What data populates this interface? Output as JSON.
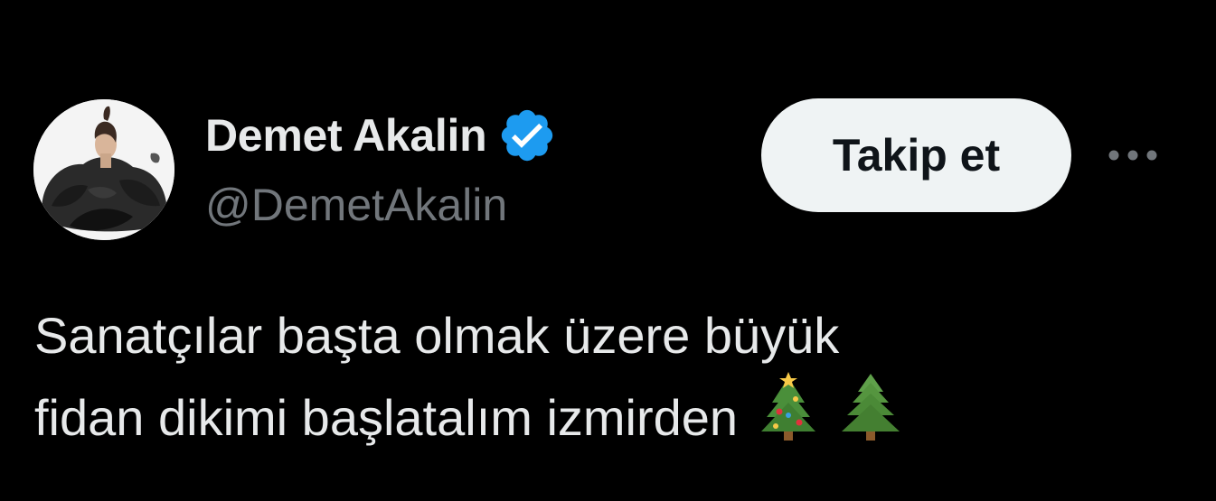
{
  "user": {
    "display_name": "Demet Akalin",
    "handle": "@DemetAkalin",
    "verified_icon": "verified-badge-icon",
    "verified_color": "#1d9bf0"
  },
  "actions": {
    "follow_label": "Takip et",
    "more_icon": "more-horizontal-icon"
  },
  "tweet": {
    "lines": [
      "Sanatçılar başta olmak üzere büyük",
      "fidan dikimi başlatalım izmirden"
    ],
    "emojis": [
      "christmas-tree-icon",
      "evergreen-tree-icon"
    ]
  },
  "colors": {
    "background": "#000000",
    "primary_text": "#e7e9ea",
    "secondary_text": "#71767b",
    "button_bg": "#eff3f4",
    "button_text": "#0f1419"
  }
}
